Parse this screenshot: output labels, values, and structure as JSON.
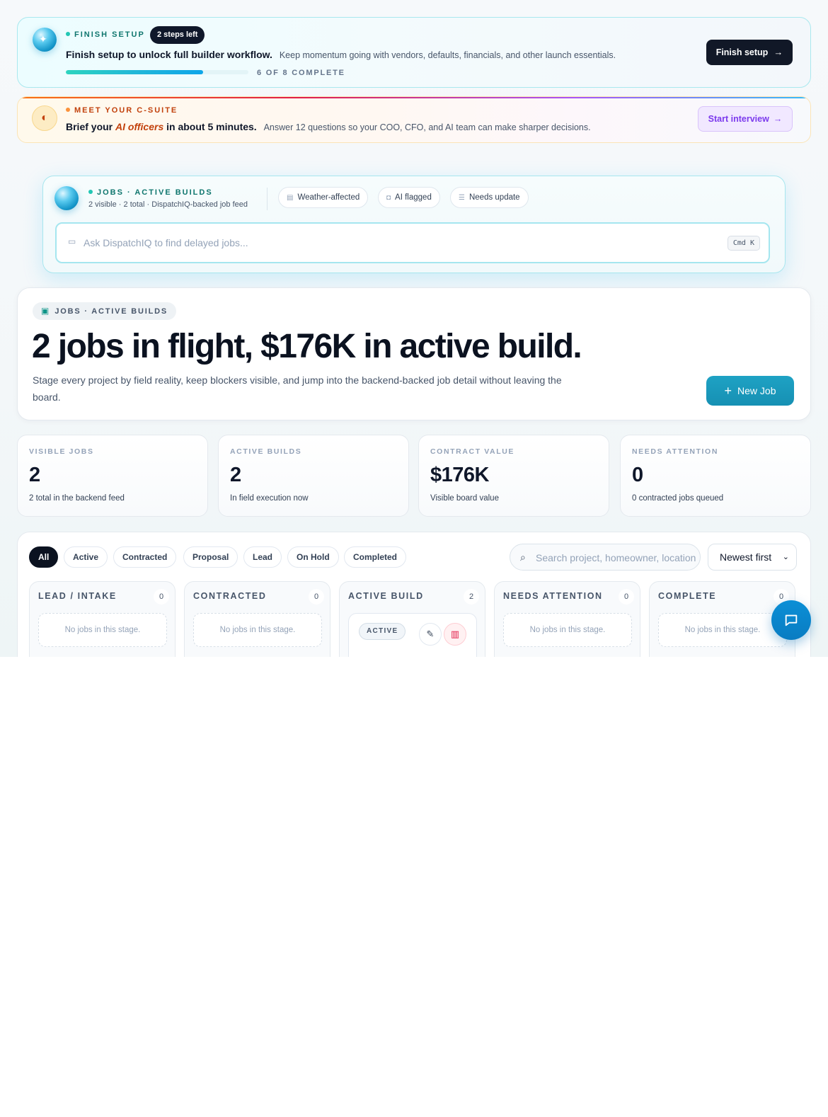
{
  "setup_banner": {
    "eyebrow": "FINISH SETUP",
    "steps_left": "2 steps left",
    "headline": "Finish setup to unlock full builder workflow.",
    "detail": "Keep momentum going with vendors, defaults, financials, and other launch essentials.",
    "progress_completed": 6,
    "progress_total": 8,
    "progress_label": "6 OF 8 COMPLETE",
    "button_label": "Finish setup"
  },
  "csuite_banner": {
    "eyebrow": "MEET YOUR C-SUITE",
    "headline_pre": "Brief your",
    "headline_highlight": "AI officers",
    "headline_post": "in about 5 minutes.",
    "detail": "Answer 12 questions so your COO, CFO, and AI team can make sharper decisions.",
    "button_label": "Start interview"
  },
  "command_bar": {
    "eyebrow": "JOBS · ACTIVE BUILDS",
    "subtitle": "2 visible · 2 total · DispatchIQ-backed job feed",
    "chips": [
      {
        "label": "Weather-affected",
        "icon": "calendar-icon"
      },
      {
        "label": "AI flagged",
        "icon": "robot-icon"
      },
      {
        "label": "Needs update",
        "icon": "sliders-icon"
      }
    ],
    "input_placeholder": "Ask DispatchIQ to find delayed jobs...",
    "shortcut": "Cmd K"
  },
  "hero": {
    "tag": "JOBS · ACTIVE BUILDS",
    "title": "2 jobs in flight, $176K in active build.",
    "description": "Stage every project by field reality, keep blockers visible, and jump into the backend-backed job detail without leaving the board.",
    "new_job_label": "New Job"
  },
  "stats": [
    {
      "label": "VISIBLE JOBS",
      "value": "2",
      "caption": "2 total in the backend feed"
    },
    {
      "label": "ACTIVE BUILDS",
      "value": "2",
      "caption": "In field execution now"
    },
    {
      "label": "CONTRACT VALUE",
      "value": "$176K",
      "caption": "Visible board value"
    },
    {
      "label": "NEEDS ATTENTION",
      "value": "0",
      "caption": "0 contracted jobs queued"
    }
  ],
  "board": {
    "filters": [
      "All",
      "Active",
      "Contracted",
      "Proposal",
      "Lead",
      "On Hold",
      "Completed"
    ],
    "active_filter": "All",
    "search_placeholder": "Search project, homeowner, location",
    "sort_value": "Newest first",
    "columns": [
      {
        "title": "LEAD / INTAKE",
        "count": "0",
        "empty_text": "No jobs in this stage."
      },
      {
        "title": "CONTRACTED",
        "count": "0",
        "empty_text": "No jobs in this stage."
      },
      {
        "title": "ACTIVE BUILD",
        "count": "2",
        "card_badge": "ACTIVE"
      },
      {
        "title": "NEEDS ATTENTION",
        "count": "0",
        "empty_text": "No jobs in this stage."
      },
      {
        "title": "COMPLETE",
        "count": "0",
        "empty_text": "No jobs in this stage."
      }
    ]
  },
  "colors": {
    "teal_accent": "#1ea2c4",
    "dark": "#0f172a",
    "orange_accent": "#c2410c",
    "violet_accent": "#7c3aed"
  }
}
